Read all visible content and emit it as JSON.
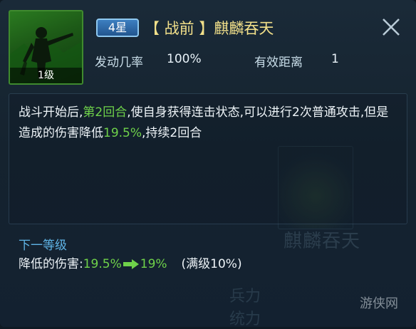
{
  "skill": {
    "level_label": "1级",
    "star_label": "4星",
    "title": "【 战前 】麒麟吞天"
  },
  "stats": {
    "trigger_label": "发动几率",
    "trigger_value": "100%",
    "range_label": "有效距离",
    "range_value": "1"
  },
  "description": {
    "part1": "战斗开始后,",
    "highlight1": "第2回合",
    "part2": ",使自身获得连击状态,可以进行2次普通攻击,但是造成的伤害降低",
    "highlight2": "19.5%",
    "part3": ",持续2回合"
  },
  "next_level": {
    "title": "下一等级",
    "label": "降低的伤害:",
    "current": "19.5%",
    "next": "19%",
    "max_note": "(满级10%)"
  },
  "background": {
    "ghost_name": "麒麟吞天",
    "ghost_side_1": "兵力",
    "ghost_side_2": "统力"
  },
  "watermark": "游侠网",
  "colors": {
    "highlight_green": "#6fd24a",
    "title_gold": "#f2e08a",
    "section_blue": "#5fb4e6"
  },
  "icons": {
    "close": "close-icon",
    "arrow": "right-arrow-icon"
  }
}
